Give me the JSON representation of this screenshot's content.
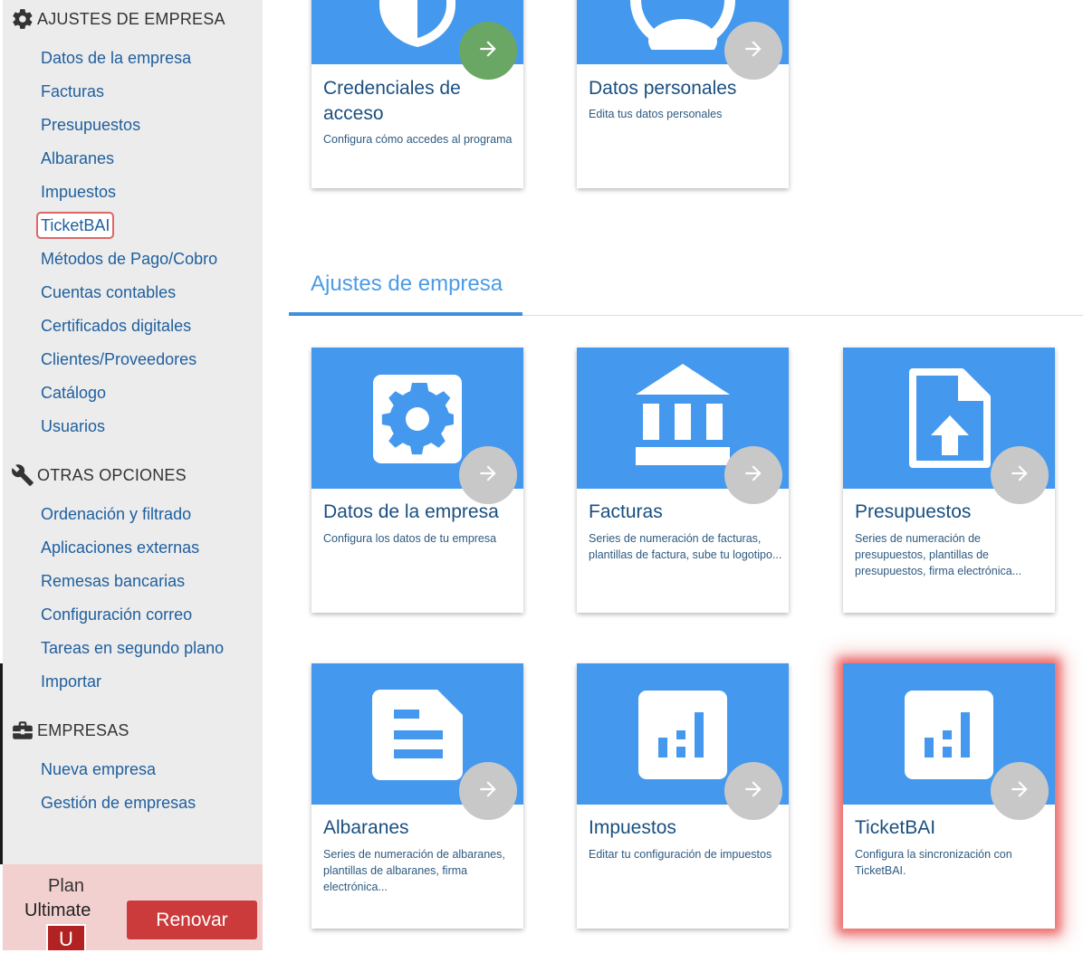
{
  "sidebar": {
    "sections": [
      {
        "title": "AJUSTES DE EMPRESA",
        "icon": "gear-icon",
        "items": [
          "Datos de la empresa",
          "Facturas",
          "Presupuestos",
          "Albaranes",
          "Impuestos",
          "TicketBAI",
          "Métodos de Pago/Cobro",
          "Cuentas contables",
          "Certificados digitales",
          "Clientes/Proveedores",
          "Catálogo",
          "Usuarios"
        ]
      },
      {
        "title": "OTRAS OPCIONES",
        "icon": "wrench-icon",
        "items": [
          "Ordenación y filtrado",
          "Aplicaciones externas",
          "Remesas bancarias",
          "Configuración correo",
          "Tareas en segundo plano",
          "Importar"
        ]
      },
      {
        "title": "EMPRESAS",
        "icon": "briefcase-icon",
        "items": [
          "Nueva empresa",
          "Gestión de empresas"
        ]
      }
    ],
    "active_item": "TicketBAI",
    "plan": {
      "label": "Plan",
      "name": "Ultimate",
      "badge": "U",
      "renew_label": "Renovar"
    }
  },
  "main": {
    "top_cards": [
      {
        "title": "Credenciales de acceso",
        "description": "Configura cómo accedes al programa",
        "icon": "shield-icon",
        "arrow_color": "#6aa664"
      },
      {
        "title": "Datos personales",
        "description": "Edita tus datos personales",
        "icon": "user-icon",
        "arrow_color": "#c8c8c8"
      }
    ],
    "section_title": "Ajustes de empresa",
    "cards": [
      {
        "title": "Datos de la empresa",
        "description": "Configura los datos de tu empresa",
        "icon": "gear-icon"
      },
      {
        "title": "Facturas",
        "description": "Series de numeración de facturas, plantillas de factura, sube tu logotipo...",
        "icon": "bank-icon"
      },
      {
        "title": "Presupuestos",
        "description": "Series de numeración de presupuestos, plantillas de presupuestos, firma electrónica...",
        "icon": "document-upload-icon"
      },
      {
        "title": "Albaranes",
        "description": "Series de numeración de albaranes, plantillas de albaranes, firma electrónica...",
        "icon": "document-lines-icon"
      },
      {
        "title": "Impuestos",
        "description": "Editar tu configuración de impuestos",
        "icon": "bar-chart-icon"
      },
      {
        "title": "TicketBAI",
        "description": "Configura la sincronización con TicketBAI.",
        "icon": "bar-chart-icon",
        "highlighted": true
      }
    ],
    "colors": {
      "banner": "#4499ee",
      "arrow_default": "#c8c8c8",
      "arrow_active": "#6aa664",
      "highlight": "#e63c3c",
      "link": "#1f5f9e"
    }
  }
}
